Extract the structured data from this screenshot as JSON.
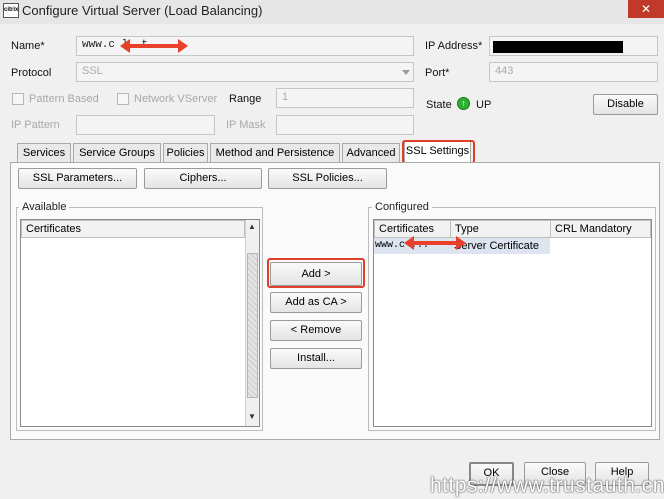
{
  "window": {
    "title": "Configure Virtual Server (Load Balancing)",
    "app_icon_text": "citrix",
    "close_glyph": "✕"
  },
  "form": {
    "name_label": "Name*",
    "name_value": "www.c        l.   t",
    "protocol_label": "Protocol",
    "protocol_value": "SSL",
    "ip_address_label": "IP Address*",
    "port_label": "Port*",
    "port_value": "443",
    "pattern_based_label": "Pattern Based",
    "network_vserver_label": "Network VServer",
    "range_label": "Range",
    "range_value": "1",
    "ip_pattern_label": "IP Pattern",
    "ip_mask_label": "IP Mask",
    "state_label": "State",
    "state_value": "UP",
    "state_glyph": "↑",
    "disable_label": "Disable"
  },
  "tabs": [
    {
      "label": "Services"
    },
    {
      "label": "Service Groups"
    },
    {
      "label": "Policies"
    },
    {
      "label": "Method and Persistence"
    },
    {
      "label": "Advanced"
    },
    {
      "label": "SSL Settings"
    }
  ],
  "ssl": {
    "ssl_params_label": "SSL Parameters...",
    "ciphers_label": "Ciphers...",
    "ssl_policies_label": "SSL Policies...",
    "available_title": "Available",
    "available_col": "Certificates",
    "configured_title": "Configured",
    "configured_cols": [
      "Certificates",
      "Type",
      "CRL Mandatory"
    ],
    "configured_rows": [
      {
        "cert": "www.c  ...",
        "type": "Server Certificate",
        "crl": ""
      }
    ],
    "add_label": "Add >",
    "add_ca_label": "Add as CA >",
    "remove_label": "< Remove",
    "install_label": "Install..."
  },
  "footer": {
    "ok_label": "OK",
    "close_label": "Close",
    "help_label": "Help"
  },
  "watermark": "https://www.trustauth.cn",
  "colors": {
    "highlight": "#e0402a",
    "state_up": "#2db02d",
    "window_bg": "#f0f0f0"
  }
}
